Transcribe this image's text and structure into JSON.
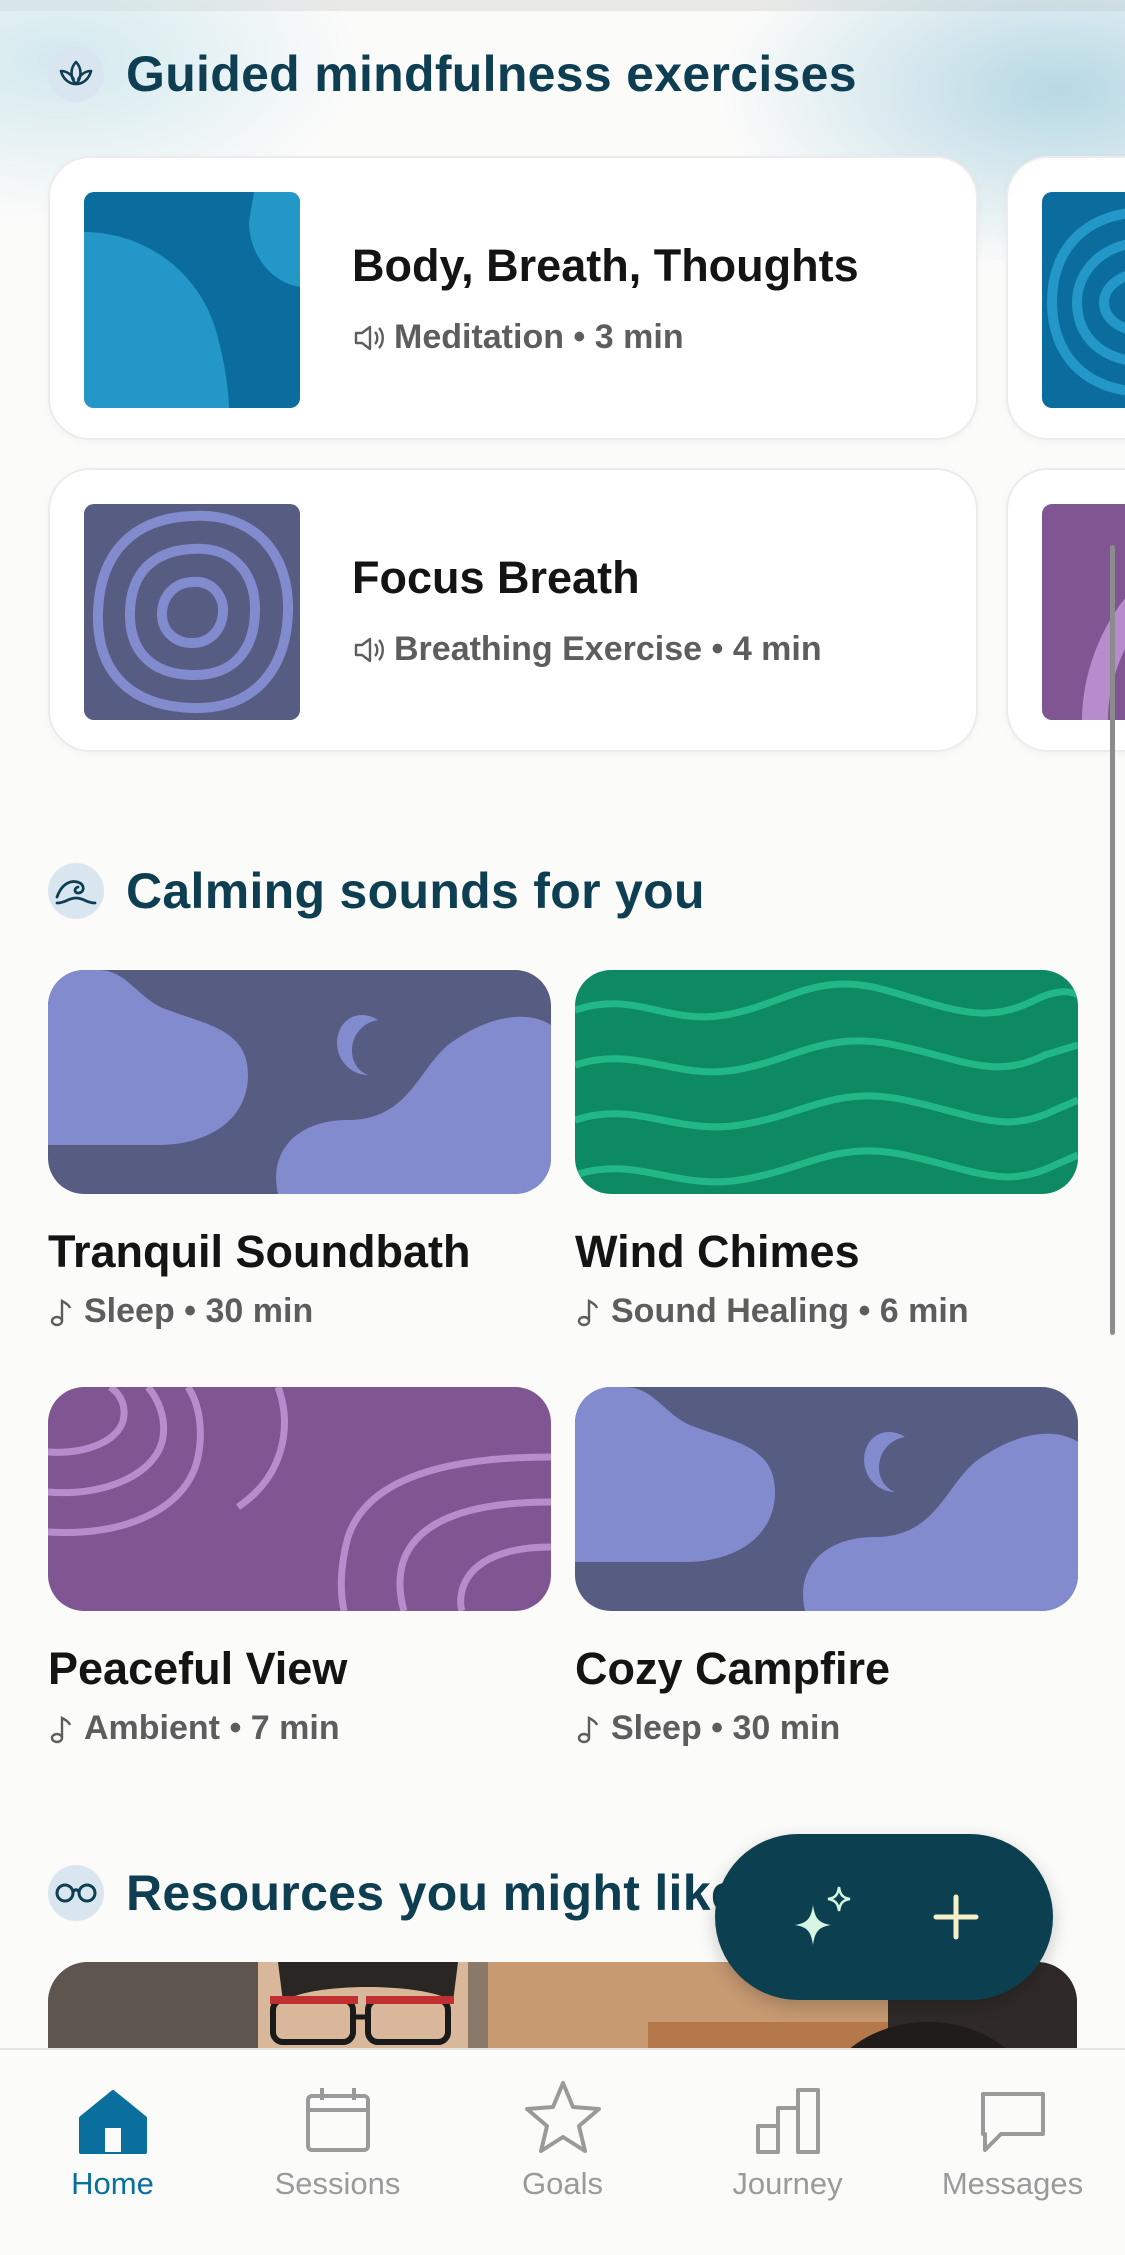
{
  "colors": {
    "accent": "#0b6f9e",
    "heading": "#0e3e52",
    "fab": "#0c4050",
    "meditation_blue": "#2497c9",
    "lavender": "#818bcd",
    "slate": "#575c82",
    "green": "#0e8a63",
    "purple": "#7f5592"
  },
  "mindfulness": {
    "title": "Guided mindfulness exercises",
    "icon": "lotus-icon",
    "items": [
      {
        "title": "Body, Breath, Thoughts",
        "type": "Meditation",
        "duration": "3 min",
        "meta": "Meditation • 3 min",
        "icon": "speaker-icon"
      },
      {
        "title": "Focus Breath",
        "type": "Breathing Exercise",
        "duration": "4 min",
        "meta": "Breathing Exercise • 4 min",
        "icon": "speaker-icon"
      }
    ]
  },
  "sounds": {
    "title": "Calming sounds for you",
    "icon": "wave-icon",
    "items": [
      {
        "title": "Tranquil Soundbath",
        "meta": "Sleep • 30 min",
        "art": "night-clouds"
      },
      {
        "title": "Wind Chimes",
        "meta": "Sound Healing • 6 min",
        "art": "green-waves"
      },
      {
        "title": "Peaceful View",
        "meta": "Ambient • 7 min",
        "art": "purple-arcs"
      },
      {
        "title": "Cozy Campfire",
        "meta": "Sleep • 30 min",
        "art": "night-clouds"
      }
    ]
  },
  "resources": {
    "title": "Resources you might like",
    "icon": "glasses-icon"
  },
  "fab": {
    "icons": [
      "sparkle-icon",
      "plus-icon"
    ]
  },
  "tabbar": {
    "tabs": [
      {
        "label": "Home",
        "icon": "home-icon",
        "active": true
      },
      {
        "label": "Sessions",
        "icon": "calendar-icon",
        "active": false
      },
      {
        "label": "Goals",
        "icon": "star-icon",
        "active": false
      },
      {
        "label": "Journey",
        "icon": "bar-chart-icon",
        "active": false
      },
      {
        "label": "Messages",
        "icon": "chat-icon",
        "active": false
      }
    ]
  }
}
